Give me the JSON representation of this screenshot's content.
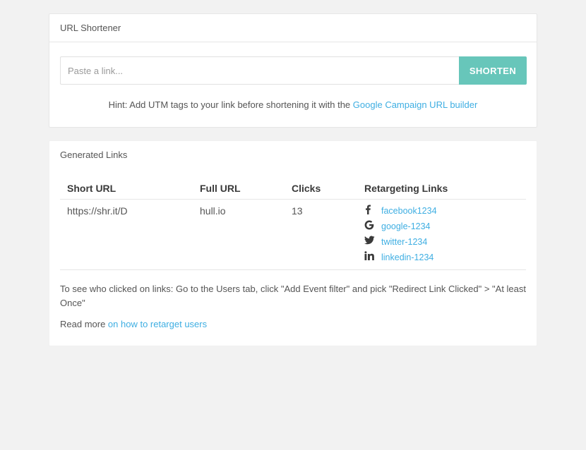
{
  "shortener": {
    "title": "URL Shortener",
    "input_placeholder": "Paste a link...",
    "button_label": "SHORTEN",
    "hint_text": "Hint: Add UTM tags to your link before shortening it with the ",
    "hint_link": "Google Campaign URL builder"
  },
  "links": {
    "title": "Generated Links",
    "columns": {
      "short_url": "Short URL",
      "full_url": "Full URL",
      "clicks": "Clicks",
      "retargeting": "Retargeting Links"
    },
    "rows": [
      {
        "short_url": "https://shr.it/D",
        "full_url": "hull.io",
        "clicks": "13",
        "retargeting": [
          {
            "icon": "facebook-icon",
            "label": "facebook1234"
          },
          {
            "icon": "google-icon",
            "label": "google-1234"
          },
          {
            "icon": "twitter-icon",
            "label": "twitter-1234"
          },
          {
            "icon": "linkedin-icon",
            "label": "linkedin-1234"
          }
        ]
      }
    ],
    "note": "To see who clicked on links: Go to the Users tab, click \"Add Event filter\" and pick \"Redirect Link Clicked\" > \"At least Once\"",
    "read_more_prefix": "Read more ",
    "read_more_link": "on how to retarget users"
  },
  "colors": {
    "accent": "#67c6ba",
    "link": "#3eaee2",
    "background": "#f2f2f2"
  }
}
